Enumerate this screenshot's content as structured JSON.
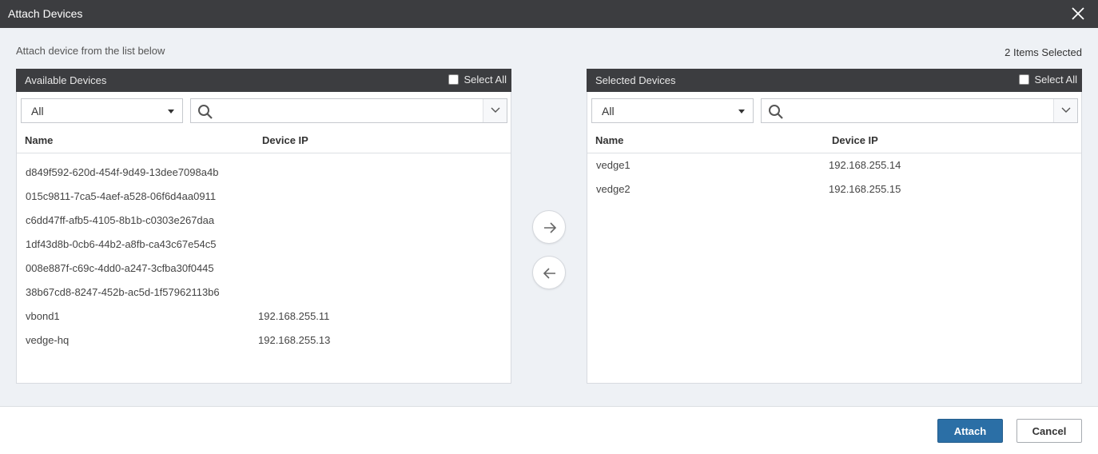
{
  "dialog": {
    "title": "Attach Devices",
    "close_icon": "close-icon"
  },
  "instruction": "Attach device from the list below",
  "selected_count": "2 Items Selected",
  "available": {
    "title": "Available Devices",
    "select_all_label": "Select All",
    "filter_value": "All",
    "search_placeholder": "",
    "columns": [
      "Name",
      "Device IP"
    ],
    "rows": [
      {
        "name": "d849f592-620d-454f-9d49-13dee7098a4b",
        "ip": ""
      },
      {
        "name": "015c9811-7ca5-4aef-a528-06f6d4aa0911",
        "ip": ""
      },
      {
        "name": "c6dd47ff-afb5-4105-8b1b-c0303e267daa",
        "ip": ""
      },
      {
        "name": "1df43d8b-0cb6-44b2-a8fb-ca43c67e54c5",
        "ip": ""
      },
      {
        "name": "008e887f-c69c-4dd0-a247-3cfba30f0445",
        "ip": ""
      },
      {
        "name": "38b67cd8-8247-452b-ac5d-1f57962113b6",
        "ip": ""
      },
      {
        "name": "vbond1",
        "ip": "192.168.255.11"
      },
      {
        "name": "vedge-hq",
        "ip": "192.168.255.13"
      }
    ]
  },
  "selected": {
    "title": "Selected Devices",
    "select_all_label": "Select All",
    "filter_value": "All",
    "search_placeholder": "",
    "columns": [
      "Name",
      "Device IP"
    ],
    "rows": [
      {
        "name": "vedge1",
        "ip": "192.168.255.14"
      },
      {
        "name": "vedge2",
        "ip": "192.168.255.15"
      }
    ]
  },
  "footer": {
    "attach_label": "Attach",
    "cancel_label": "Cancel"
  },
  "colors": {
    "header_bg": "#3c3d40",
    "accent": "#2b6fa6",
    "page_bg": "#eef1f5"
  }
}
